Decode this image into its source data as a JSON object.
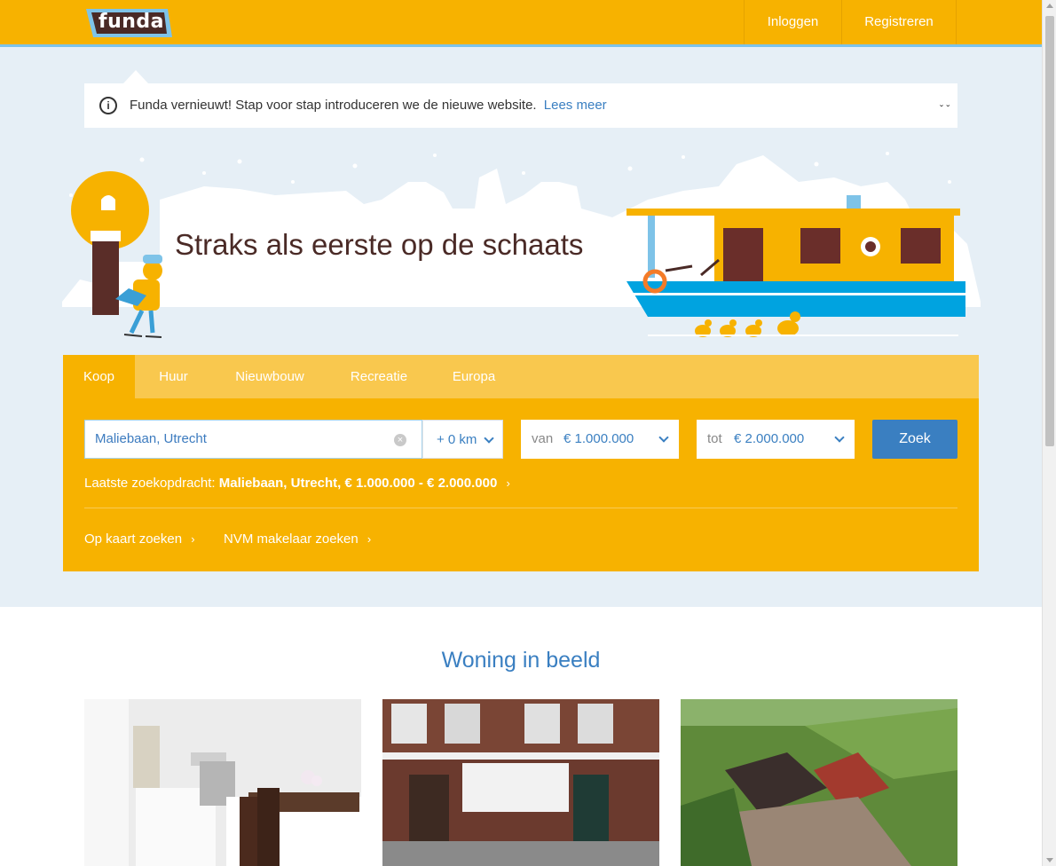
{
  "header": {
    "logo_text": "funda",
    "login_label": "Inloggen",
    "register_label": "Registreren"
  },
  "notice": {
    "text": "Funda vernieuwt! Stap voor stap introduceren we de nieuwe website.",
    "link_label": "Lees meer",
    "info_glyph": "i",
    "close_glyph": "ˇ ˇ"
  },
  "hero": {
    "title": "Straks als eerste op de schaats"
  },
  "search": {
    "tabs": [
      {
        "label": "Koop"
      },
      {
        "label": "Huur"
      },
      {
        "label": "Nieuwbouw"
      },
      {
        "label": "Recreatie"
      },
      {
        "label": "Europa"
      }
    ],
    "query_value": "Maliebaan, Utrecht",
    "radius_value": "+ 0 km",
    "price_from_label": "van",
    "price_from_value": "€ 1.000.000",
    "price_to_label": "tot",
    "price_to_value": "€ 2.000.000",
    "submit_label": "Zoek",
    "last_search_prefix": "Laatste zoekopdracht:",
    "last_search_value": "Maliebaan, Utrecht, € 1.000.000 - € 2.000.000",
    "map_link_label": "Op kaart zoeken",
    "nvm_link_label": "NVM makelaar zoeken",
    "clear_glyph": "×",
    "arrow_glyph": "›"
  },
  "featured": {
    "title": "Woning in beeld",
    "photos": [
      {
        "icon": "kitchen-interior-photo"
      },
      {
        "icon": "brick-houses-photo"
      },
      {
        "icon": "aerial-farm-photo"
      }
    ]
  },
  "colors": {
    "brand_yellow": "#f7b200",
    "brand_blue": "#3a7fc1",
    "hero_bg": "#e6eff6",
    "title_brown": "#4a2a26"
  }
}
